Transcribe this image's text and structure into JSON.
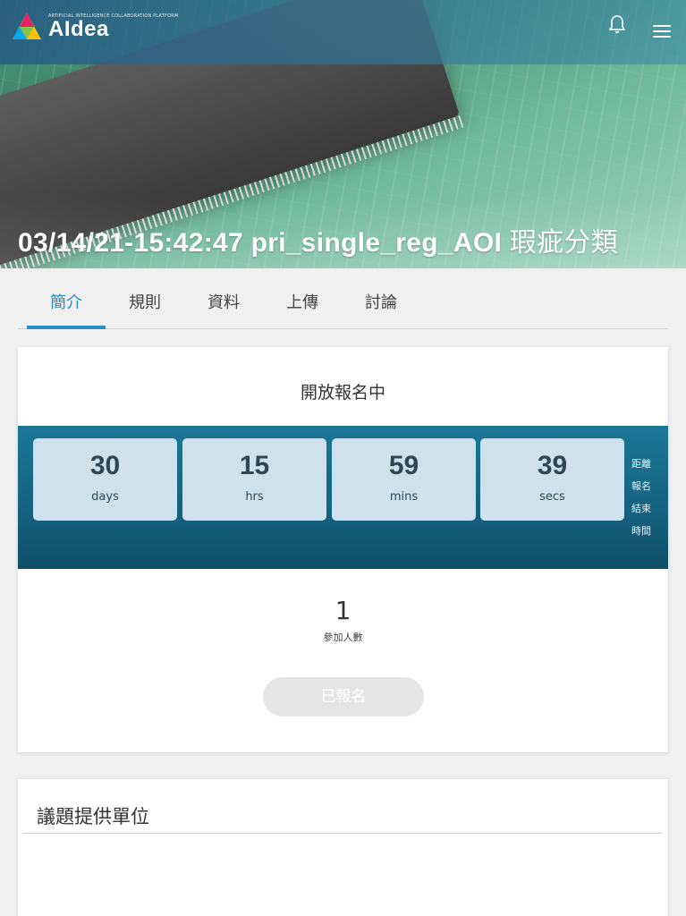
{
  "header": {
    "logo_small": "ARTIFICIAL INTELLIGENCE COLLABORATION PLATFORM",
    "logo_text": "AIdea",
    "bell_icon": "bell-icon",
    "menu_icon": "hamburger-menu-icon"
  },
  "hero": {
    "title_main": "03/14/21-15:42:47 pri_single_reg_AOI",
    "title_cn": "瑕疵分類"
  },
  "tabs": [
    {
      "label": "簡介",
      "active": true
    },
    {
      "label": "規則",
      "active": false
    },
    {
      "label": "資料",
      "active": false
    },
    {
      "label": "上傳",
      "active": false
    },
    {
      "label": "討論",
      "active": false
    }
  ],
  "overview": {
    "status": "開放報名中",
    "countdown": [
      {
        "value": "30",
        "unit": "days"
      },
      {
        "value": "15",
        "unit": "hrs"
      },
      {
        "value": "59",
        "unit": "mins"
      },
      {
        "value": "39",
        "unit": "secs"
      }
    ],
    "countdown_note": "距離報名結束時間",
    "participants": "1",
    "participants_label": "參加人數",
    "register_button": "已報名"
  },
  "provider": {
    "title": "議題提供單位"
  },
  "colors": {
    "accent": "#2a8fc7",
    "countdown_bg": "#14627f",
    "countdown_box": "#cfe1ea"
  }
}
